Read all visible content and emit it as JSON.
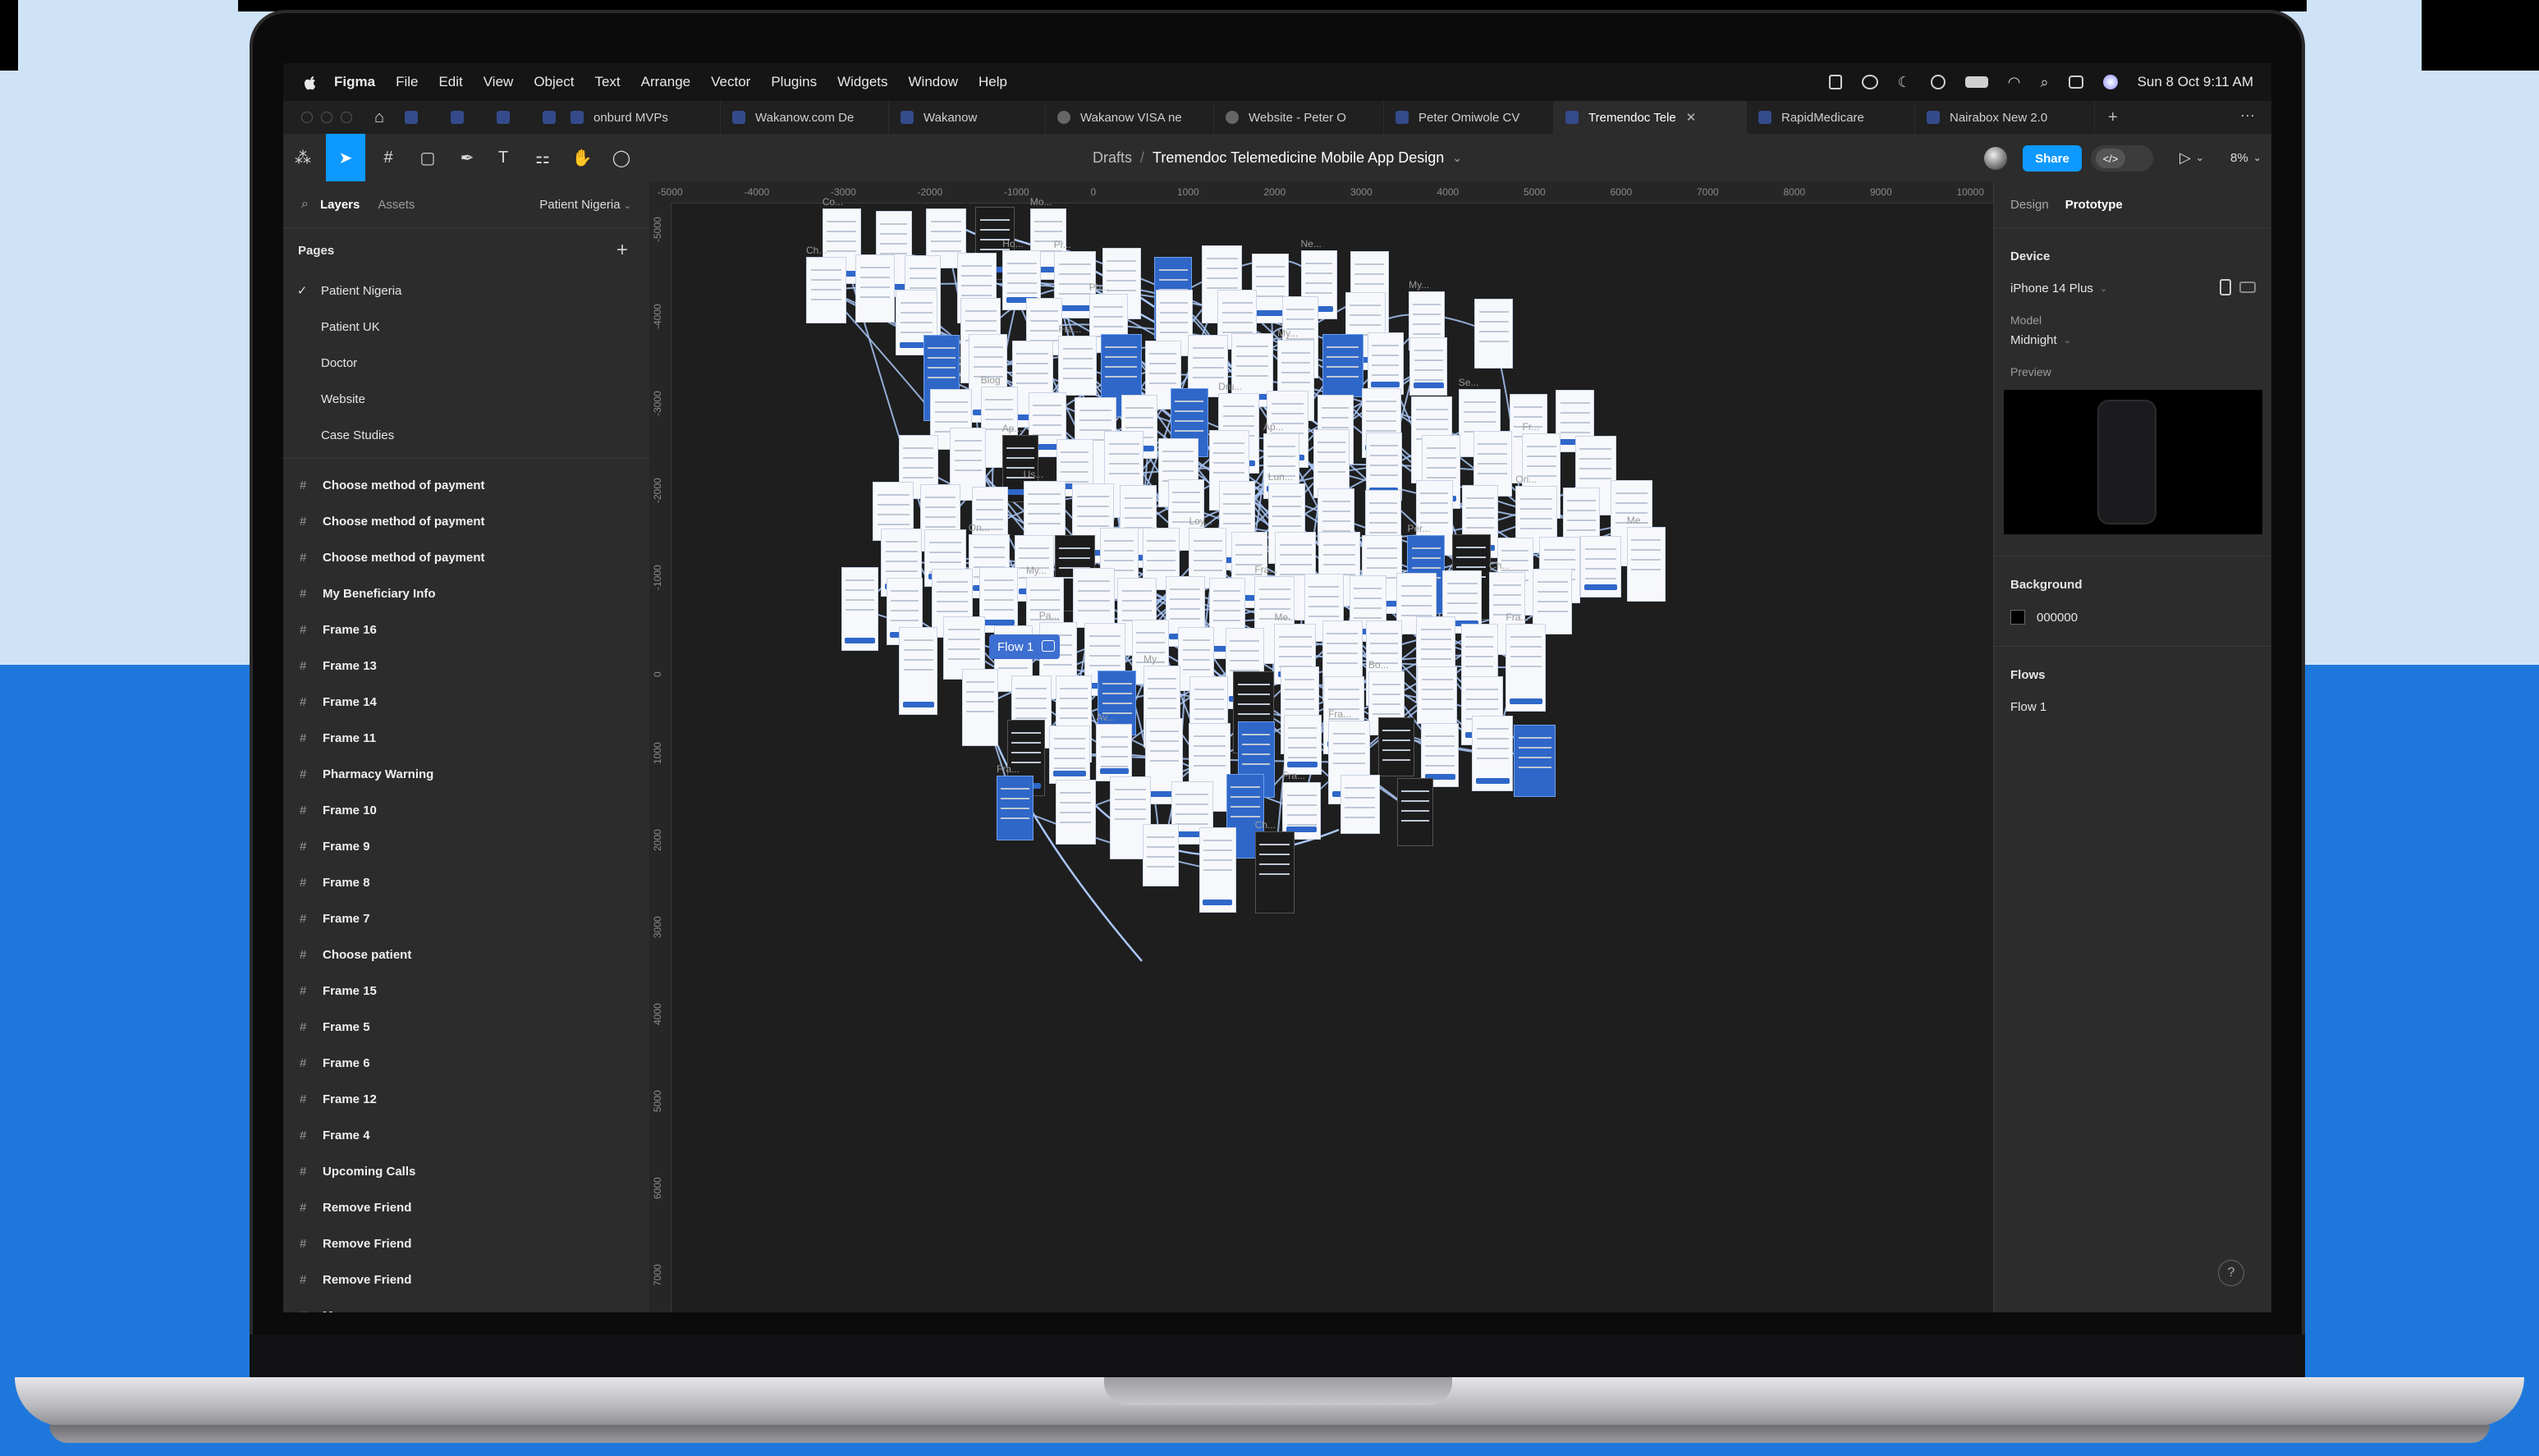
{
  "menubar": {
    "app": "Figma",
    "menus": [
      "File",
      "Edit",
      "View",
      "Object",
      "Text",
      "Arrange",
      "Vector",
      "Plugins",
      "Widgets",
      "Window",
      "Help"
    ],
    "clock": "Sun 8 Oct  9:11 AM"
  },
  "tabs": [
    {
      "label": "onburd MVPs"
    },
    {
      "label": "Wakanow.com De"
    },
    {
      "label": "Wakanow"
    },
    {
      "label": "Wakanow VISA ne"
    },
    {
      "label": "Website - Peter O"
    },
    {
      "label": "Peter Omiwole CV"
    },
    {
      "label": "Tremendoc Tele"
    },
    {
      "label": "RapidMedicare"
    },
    {
      "label": "Nairabox New 2.0"
    }
  ],
  "toolbar": {
    "breadcrumb_folder": "Drafts",
    "breadcrumb_sep": "/",
    "file_name": "Tremendoc Telemedicine Mobile App Design",
    "share_label": "Share",
    "zoom": "8%"
  },
  "left_panel": {
    "tab_layers": "Layers",
    "tab_assets": "Assets",
    "current_page": "Patient Nigeria",
    "pages_heading": "Pages",
    "pages": [
      "Patient Nigeria",
      "Patient UK",
      "Doctor",
      "Website",
      "Case Studies"
    ],
    "layers": [
      "Choose method of payment",
      "Choose method of payment",
      "Choose method of payment",
      "My Beneficiary Info",
      "Frame 16",
      "Frame 13",
      "Frame 14",
      "Frame 11",
      "Pharmacy Warning",
      "Frame 10",
      "Frame 9",
      "Frame 8",
      "Frame 7",
      "Choose patient",
      "Frame 15",
      "Frame 5",
      "Frame 6",
      "Frame 12",
      "Frame 4",
      "Upcoming Calls",
      "Remove Friend",
      "Remove Friend",
      "Remove Friend",
      "Menu"
    ]
  },
  "canvas": {
    "ruler_x": [
      "-5000",
      "-4000",
      "-3000",
      "-2000",
      "-1000",
      "0",
      "1000",
      "2000",
      "3000",
      "4000",
      "5000",
      "6000",
      "7000",
      "8000",
      "9000",
      "10000"
    ],
    "ruler_y": [
      "-5000",
      "-4000",
      "-3000",
      "-2000",
      "-1000",
      "0",
      "1000",
      "2000",
      "3000",
      "4000",
      "5000",
      "6000",
      "7000"
    ],
    "flow_tag": "Flow 1",
    "frame_labels": [
      "Co...",
      "Ch...",
      "Pr...",
      "Ne...",
      "Ph...",
      "My...",
      "Fra...",
      "My...",
      "Blog",
      "Dru...",
      "Se...",
      "Ap...",
      "Ap...",
      "Fr...",
      "Us...",
      "Lun...",
      "On...",
      "On...",
      "Loy...",
      "Per...",
      "Me...",
      "My...",
      "Fra...",
      "Ch...",
      "Pa...",
      "Me...",
      "Fra...",
      "My...",
      "Bo...",
      "Av...",
      "Fra...",
      "Fra...",
      "Fra...",
      "Ch...",
      "Mo...",
      "Ho..."
    ]
  },
  "right_panel": {
    "tab_design": "Design",
    "tab_prototype": "Prototype",
    "device_heading": "Device",
    "device": "iPhone 14 Plus",
    "model_label": "Model",
    "model": "Midnight",
    "preview_label": "Preview",
    "background_heading": "Background",
    "background_hex": "000000",
    "flows_heading": "Flows",
    "flow_item": "Flow 1"
  },
  "colors": {
    "accent": "#0d99ff",
    "backdrop_top": "#cfe3f7",
    "backdrop_bottom": "#1e78dc",
    "flow_lines": "#a9c6f5"
  }
}
